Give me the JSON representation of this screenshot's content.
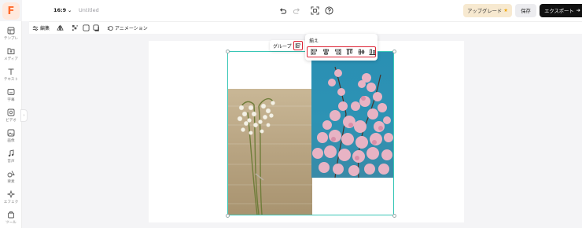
{
  "app": {
    "logo_letter": "F",
    "aspect_ratio": "16:9",
    "document_title": "Untitled"
  },
  "header": {
    "upgrade_label": "アップグレード",
    "save_label": "保存",
    "export_label": "エクスポート"
  },
  "sidebar": {
    "items": [
      {
        "label": "テンプレ",
        "icon": "template-icon"
      },
      {
        "label": "メディア",
        "icon": "folder-upload-icon"
      },
      {
        "label": "テキスト",
        "icon": "text-icon"
      },
      {
        "label": "字幕",
        "icon": "subtitle-icon"
      },
      {
        "label": "ビデオ",
        "icon": "video-icon"
      },
      {
        "label": "画像",
        "icon": "image-icon"
      },
      {
        "label": "音声",
        "icon": "music-icon"
      },
      {
        "label": "要素",
        "icon": "elements-icon"
      },
      {
        "label": "エフェク",
        "icon": "effects-icon"
      },
      {
        "label": "ツール",
        "icon": "tools-icon"
      }
    ]
  },
  "toolbar": {
    "edit_label": "編集",
    "animation_label": "アニメーション"
  },
  "selection": {
    "group_label": "グループ"
  },
  "align_popup": {
    "title": "揃え",
    "buttons": [
      "align-left",
      "align-center",
      "align-right",
      "align-top",
      "align-middle",
      "align-bottom"
    ]
  },
  "colors": {
    "brand": "#ff6a2b",
    "selection": "#38c6b6",
    "highlight": "#dd2233"
  }
}
